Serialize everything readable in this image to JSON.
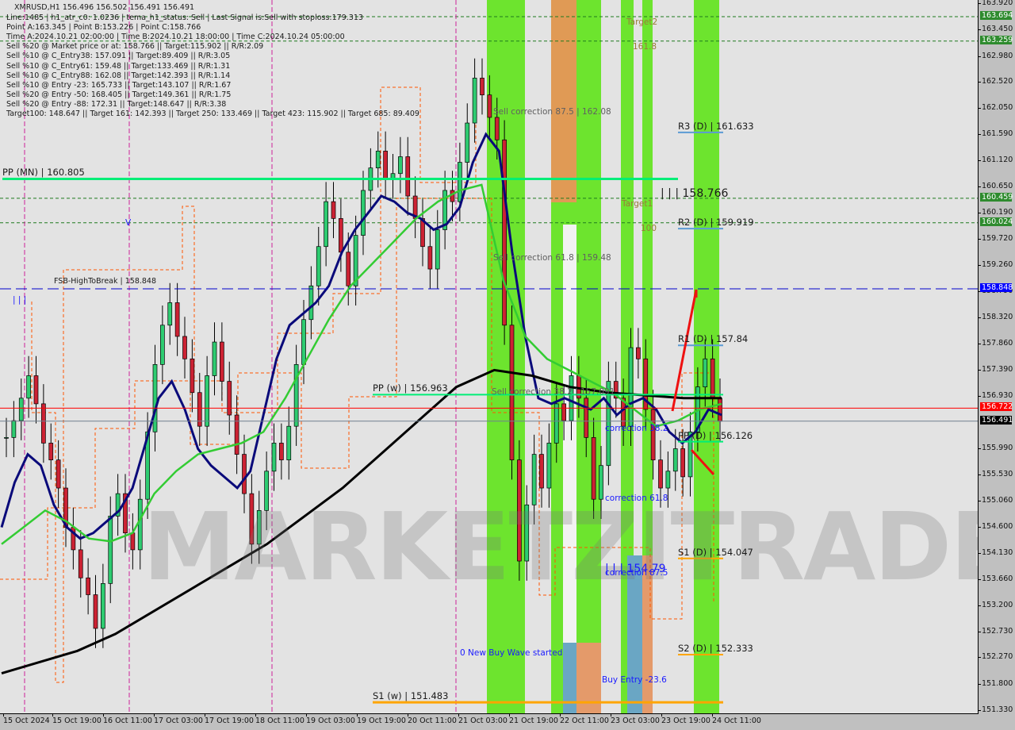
{
  "header": {
    "symbol_line": "XMRUSD,H1  156.496 156.502 156.491 156.491",
    "info_lines": [
      "Line:1485 | h1_atr_c0: 1.0236 | tema_h1_status: Sell | Last Signal is:Sell with stoploss:179.313",
      "Point A:163.345 | Point B:153.226 | Point C:158.766",
      "Time A:2024.10.21 02:00:00 | Time B:2024.10.21 18:00:00 | Time C:2024.10.24 05:00:00",
      "Sell %20 @ Market price or at: 158.766 || Target:115.902 || R/R:2.09",
      "Sell %10 @ C_Entry38: 157.091 || Target:89.409 || R/R:3.05",
      "Sell %10 @ C_Entry61: 159.48 || Target:133.469 || R/R:1.31",
      "Sell %10 @ C_Entry88: 162.08 || Target:142.393 || R/R:1.14",
      "Sell %10 @ Entry -23: 165.733 || Target:143.107 || R/R:1.67",
      "Sell %20 @ Entry -50: 168.405 || Target:149.361 || R/R:1.75",
      "Sell %20 @ Entry -88: 172.31 || Target:148.647 || R/R:3.38",
      "Target100: 148.647 || Target 161: 142.393 || Target 250: 133.469 || Target 423: 115.902 || Target 685: 89.409"
    ]
  },
  "watermark": "MARKETZITRADE",
  "chart_data": {
    "type": "candlestick",
    "symbol": "XMRUSD",
    "timeframe": "H1",
    "ohlc_last": {
      "open": 156.496,
      "high": 156.502,
      "low": 156.491,
      "close": 156.491
    },
    "ylim": [
      151.33,
      163.92
    ],
    "y_ticks": [
      163.92,
      163.45,
      162.98,
      162.52,
      162.05,
      161.59,
      161.12,
      160.65,
      160.19,
      159.72,
      159.26,
      158.79,
      158.32,
      157.86,
      157.39,
      156.93,
      155.99,
      155.53,
      155.06,
      154.6,
      154.13,
      153.66,
      153.2,
      152.73,
      152.27,
      151.8,
      151.33
    ],
    "y_tick_labels": [
      "163.920",
      "163.450",
      "162.980",
      "162.520",
      "162.050",
      "161.590",
      "161.120",
      "160.650",
      "160.190",
      "159.720",
      "159.260",
      "158.790",
      "158.320",
      "157.860",
      "157.390",
      "156.930",
      "155.990",
      "155.530",
      "155.060",
      "154.600",
      "154.130",
      "153.660",
      "153.200",
      "152.730",
      "152.270",
      "151.800",
      "151.330"
    ],
    "x_tick_labels": [
      "15 Oct 2024",
      "15 Oct 19:00",
      "16 Oct 11:00",
      "17 Oct 03:00",
      "17 Oct 19:00",
      "18 Oct 11:00",
      "19 Oct 03:00",
      "19 Oct 19:00",
      "20 Oct 11:00",
      "21 Oct 03:00",
      "21 Oct 19:00",
      "22 Oct 11:00",
      "23 Oct 03:00",
      "23 Oct 19:00",
      "24 Oct 11:00"
    ],
    "price_badges": [
      {
        "value": "163.694",
        "bg": "#2e8b2e",
        "fg": "#ffffff"
      },
      {
        "value": "163.259",
        "bg": "#2e8b2e",
        "fg": "#ffffff"
      },
      {
        "value": "160.459",
        "bg": "#2e8b2e",
        "fg": "#ffffff"
      },
      {
        "value": "160.024",
        "bg": "#2e8b2e",
        "fg": "#ffffff"
      },
      {
        "value": "158.848",
        "bg": "#0000ff",
        "fg": "#ffffff"
      },
      {
        "value": "156.722",
        "bg": "#ff0000",
        "fg": "#ffffff"
      },
      {
        "value": "156.491",
        "bg": "#000000",
        "fg": "#ffffff"
      }
    ],
    "levels": [
      {
        "label": "PP (MN) | 160.805",
        "price": 160.805,
        "color": "#00ee77",
        "style": "solid-thick"
      },
      {
        "label": "PP (w) | 156.963",
        "price": 156.963,
        "color": "#00ee77",
        "style": "solid-thick"
      },
      {
        "label": "S1 (w) | 151.483",
        "price": 151.483,
        "color": "#ffa500",
        "style": "solid-thick"
      },
      {
        "label": "R3 (D) | 161.633",
        "price": 161.633,
        "color": "#5b9bd5",
        "style": "solid"
      },
      {
        "label": "R2 (D) | 159.919",
        "price": 159.919,
        "color": "#5b9bd5",
        "style": "solid"
      },
      {
        "label": "R1 (D) | 157.84",
        "price": 157.84,
        "color": "#5b9bd5",
        "style": "solid"
      },
      {
        "label": "PP (D) | 156.126",
        "price": 156.126,
        "color": "#00ee77",
        "style": "solid"
      },
      {
        "label": "S1 (D) | 154.047",
        "price": 154.047,
        "color": "#ffa500",
        "style": "solid"
      },
      {
        "label": "S2 (D) | 152.333",
        "price": 152.333,
        "color": "#ffa500",
        "style": "solid"
      },
      {
        "label": "FSB-HighToBreak | 158.848",
        "price": 158.848,
        "color": "#0000cc",
        "style": "dashed"
      },
      {
        "label": "",
        "price": 156.722,
        "color": "#ff0000",
        "style": "solid"
      },
      {
        "label": "",
        "price": 156.491,
        "color": "#708090",
        "style": "solid"
      }
    ],
    "annotations": [
      {
        "text": "Sell correction 87.5 | 162.08",
        "kind": "grey"
      },
      {
        "text": "Sell correction 61.8 | 159.48",
        "kind": "grey"
      },
      {
        "text": "Sell correction 38.2 | 157.091",
        "kind": "grey"
      },
      {
        "text": "| | | 158.766",
        "kind": "black"
      },
      {
        "text": "| | | 154.79",
        "kind": "blue"
      },
      {
        "text": "correction 38.2",
        "kind": "blue"
      },
      {
        "text": "correction 61.8",
        "kind": "blue"
      },
      {
        "text": "correction 87.5",
        "kind": "blue"
      },
      {
        "text": "0 New Buy Wave started",
        "kind": "blue"
      },
      {
        "text": "Buy Entry -23.6",
        "kind": "blue"
      },
      {
        "text": "Target2",
        "kind": "olive"
      },
      {
        "text": "161.8",
        "kind": "olive"
      },
      {
        "text": "Target1",
        "kind": "olive"
      },
      {
        "text": "100",
        "kind": "olive"
      },
      {
        "text": "| | |",
        "kind": "blue"
      },
      {
        "text": "V",
        "kind": "blue"
      }
    ],
    "target_lines": [
      163.694,
      163.259,
      160.459,
      160.024
    ],
    "series": [
      {
        "name": "price-close",
        "color": "#000000",
        "values": [
          156.2,
          156.5,
          156.9,
          157.3,
          156.8,
          156.1,
          155.8,
          155.3,
          154.6,
          154.2,
          153.7,
          153.4,
          152.8,
          153.6,
          154.8,
          155.2,
          154.5,
          154.2,
          155.1,
          156.3,
          157.5,
          158.2,
          158.6,
          158.0,
          157.6,
          157.0,
          156.4,
          157.3,
          157.9,
          157.2,
          156.6,
          155.9,
          155.2,
          154.3,
          154.9,
          155.6,
          156.1,
          155.8,
          156.4,
          157.5,
          158.3,
          158.9,
          159.6,
          160.4,
          160.1,
          159.5,
          158.9,
          159.8,
          160.6,
          161.0,
          161.3,
          160.8,
          160.9,
          161.2,
          160.5,
          160.1,
          159.6,
          159.2,
          159.9,
          160.6,
          160.4,
          161.1,
          161.8,
          162.6,
          162.3,
          161.9,
          161.5,
          158.2,
          155.8,
          154.0,
          155.0,
          155.9,
          155.3,
          156.1,
          156.8,
          156.5,
          157.3,
          156.9,
          156.2,
          155.1,
          155.7,
          157.2,
          156.9,
          156.4,
          157.8,
          157.6,
          156.7,
          155.8,
          155.3,
          155.6,
          156.0,
          155.5,
          156.3,
          157.1,
          157.6,
          156.9,
          156.49
        ]
      },
      {
        "name": "tema-fast",
        "color": "#0a0a7a",
        "values": [
          154.6,
          155.4,
          155.9,
          155.7,
          155.0,
          154.6,
          154.4,
          154.5,
          154.7,
          154.9,
          155.3,
          156.1,
          156.9,
          157.2,
          156.7,
          156.0,
          155.7,
          155.5,
          155.3,
          155.6,
          156.6,
          157.6,
          158.2,
          158.4,
          158.6,
          158.9,
          159.5,
          159.9,
          160.2,
          160.5,
          160.4,
          160.2,
          160.1,
          159.9,
          160.0,
          160.3,
          161.1,
          161.6,
          161.3,
          159.5,
          158.0,
          156.9,
          156.8,
          156.9,
          156.8,
          156.7,
          156.9,
          156.6,
          156.8,
          156.9,
          156.7,
          156.3,
          156.1,
          156.3,
          156.7,
          156.6
        ]
      },
      {
        "name": "ma-green",
        "color": "#33cc33",
        "values": [
          154.3,
          154.6,
          154.9,
          154.7,
          154.4,
          154.35,
          154.5,
          155.2,
          155.6,
          155.9,
          156.0,
          156.1,
          156.3,
          156.9,
          157.6,
          158.3,
          158.9,
          159.3,
          159.7,
          160.1,
          160.4,
          160.6,
          160.7,
          159.0,
          158.0,
          157.6,
          157.4,
          157.2,
          157.0,
          156.7,
          156.4,
          156.5,
          156.7,
          156.8
        ]
      },
      {
        "name": "ma-black",
        "color": "#000000",
        "values": [
          152.0,
          152.2,
          152.4,
          152.7,
          153.1,
          153.5,
          153.9,
          154.3,
          154.8,
          155.3,
          155.9,
          156.5,
          157.1,
          157.4,
          157.3,
          157.1,
          157.0,
          156.95,
          156.9,
          156.9
        ]
      }
    ]
  }
}
